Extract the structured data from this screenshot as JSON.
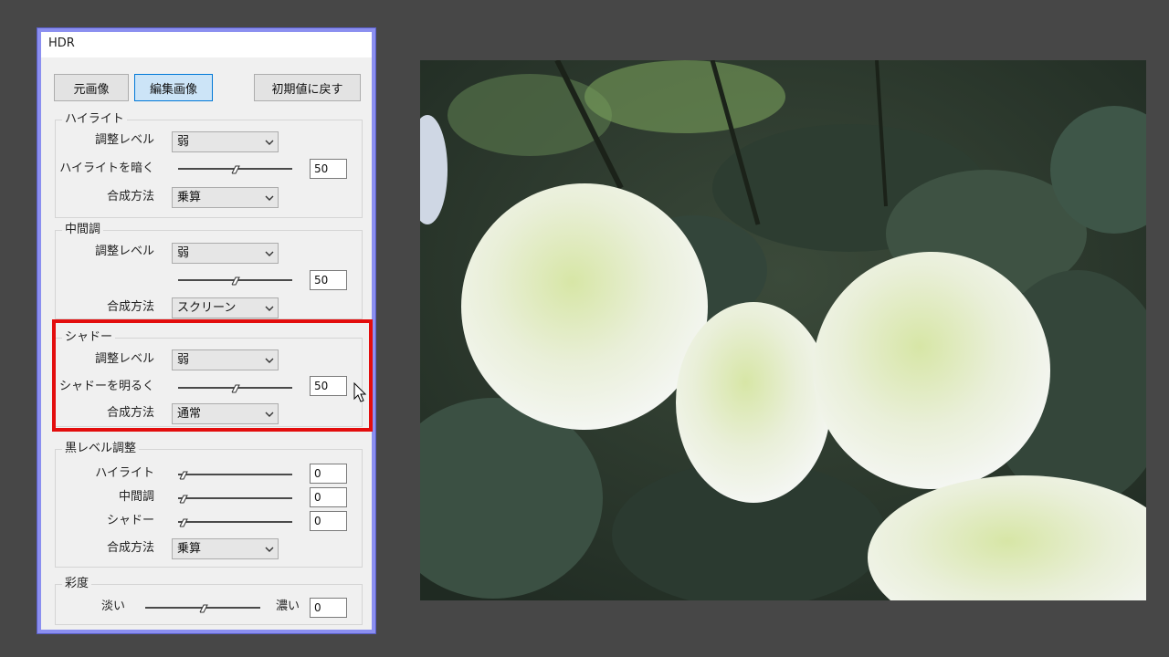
{
  "dialog": {
    "title": "HDR",
    "buttons": {
      "original": "元画像",
      "edited": "編集画像",
      "reset": "初期値に戻す"
    },
    "highlight_group": {
      "title": "ハイライト",
      "level_label": "調整レベル",
      "level_value": "弱",
      "slider_label": "ハイライトを暗く",
      "slider_value": "50",
      "blend_label": "合成方法",
      "blend_value": "乗算"
    },
    "midtone_group": {
      "title": "中間調",
      "level_label": "調整レベル",
      "level_value": "弱",
      "slider_value": "50",
      "blend_label": "合成方法",
      "blend_value": "スクリーン"
    },
    "shadow_group": {
      "title": "シャドー",
      "level_label": "調整レベル",
      "level_value": "弱",
      "slider_label": "シャドーを明るく",
      "slider_value": "50",
      "blend_label": "合成方法",
      "blend_value": "通常"
    },
    "black_level_group": {
      "title": "黒レベル調整",
      "highlight_label": "ハイライト",
      "highlight_value": "0",
      "midtone_label": "中間調",
      "midtone_value": "0",
      "shadow_label": "シャドー",
      "shadow_value": "0",
      "blend_label": "合成方法",
      "blend_value": "乗算"
    },
    "saturation_group": {
      "title": "彩度",
      "low_label": "淡い",
      "high_label": "濃い",
      "value": "0"
    }
  },
  "colors": {
    "background": "#474747",
    "dialog_border": "#8b8ff0",
    "highlight_box": "#e30d0d",
    "active_button": "#cce4f7"
  },
  "preview": {
    "icon": "hydrangea-photo"
  }
}
